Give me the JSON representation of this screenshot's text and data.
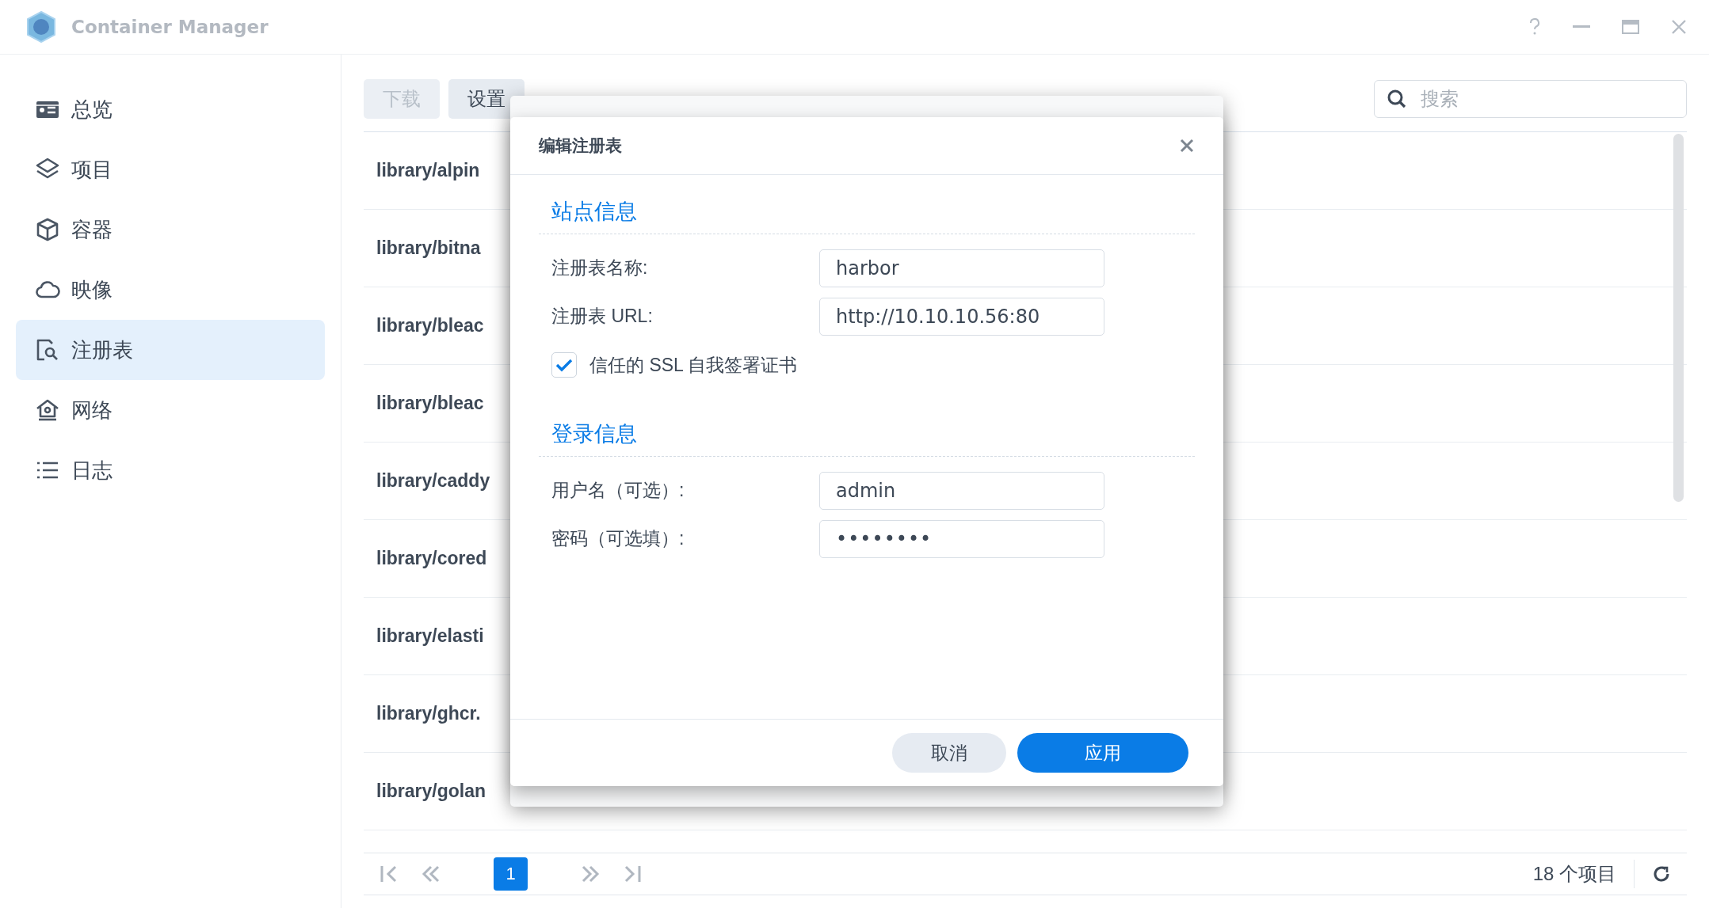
{
  "window": {
    "title": "Container Manager"
  },
  "sidebar": {
    "items": [
      {
        "label": "总览",
        "kind": "overview",
        "selected": false
      },
      {
        "label": "项目",
        "kind": "project",
        "selected": false
      },
      {
        "label": "容器",
        "kind": "container",
        "selected": false
      },
      {
        "label": "映像",
        "kind": "image",
        "selected": false
      },
      {
        "label": "注册表",
        "kind": "registry",
        "selected": true
      },
      {
        "label": "网络",
        "kind": "network",
        "selected": false
      },
      {
        "label": "日志",
        "kind": "log",
        "selected": false
      }
    ]
  },
  "toolbar": {
    "buttons": [
      {
        "label": "下载",
        "disabled": true
      },
      {
        "label": "设置",
        "disabled": false
      }
    ],
    "search": {
      "placeholder": "搜索"
    }
  },
  "list": {
    "rows": [
      "library/alpin",
      "library/bitna",
      "library/bleac",
      "library/bleac",
      "library/caddy",
      "library/cored",
      "library/elasti",
      "library/ghcr.",
      "library/golan"
    ]
  },
  "pagination": {
    "pages": [
      {
        "label": "1",
        "selected": true
      }
    ],
    "count": "18 个项目"
  },
  "dialog": {
    "title": "编辑注册表",
    "sections": [
      {
        "title": "站点信息",
        "fields": [
          {
            "label": "注册表名称:",
            "value": "harbor",
            "kind": "text"
          },
          {
            "label": "注册表 URL:",
            "value": "http://10.10.10.56:80",
            "kind": "text"
          }
        ],
        "checkbox": {
          "label": "信任的 SSL 自我签署证书",
          "checked": true
        }
      },
      {
        "title": "登录信息",
        "fields": [
          {
            "label": "用户名（可选）:",
            "value": "admin",
            "kind": "text"
          },
          {
            "label": "密码（可选填）:",
            "value": "••••••••",
            "kind": "password"
          }
        ]
      }
    ],
    "buttons": [
      {
        "label": "取消",
        "kind": "secondary"
      },
      {
        "label": "应用",
        "kind": "primary"
      }
    ]
  }
}
